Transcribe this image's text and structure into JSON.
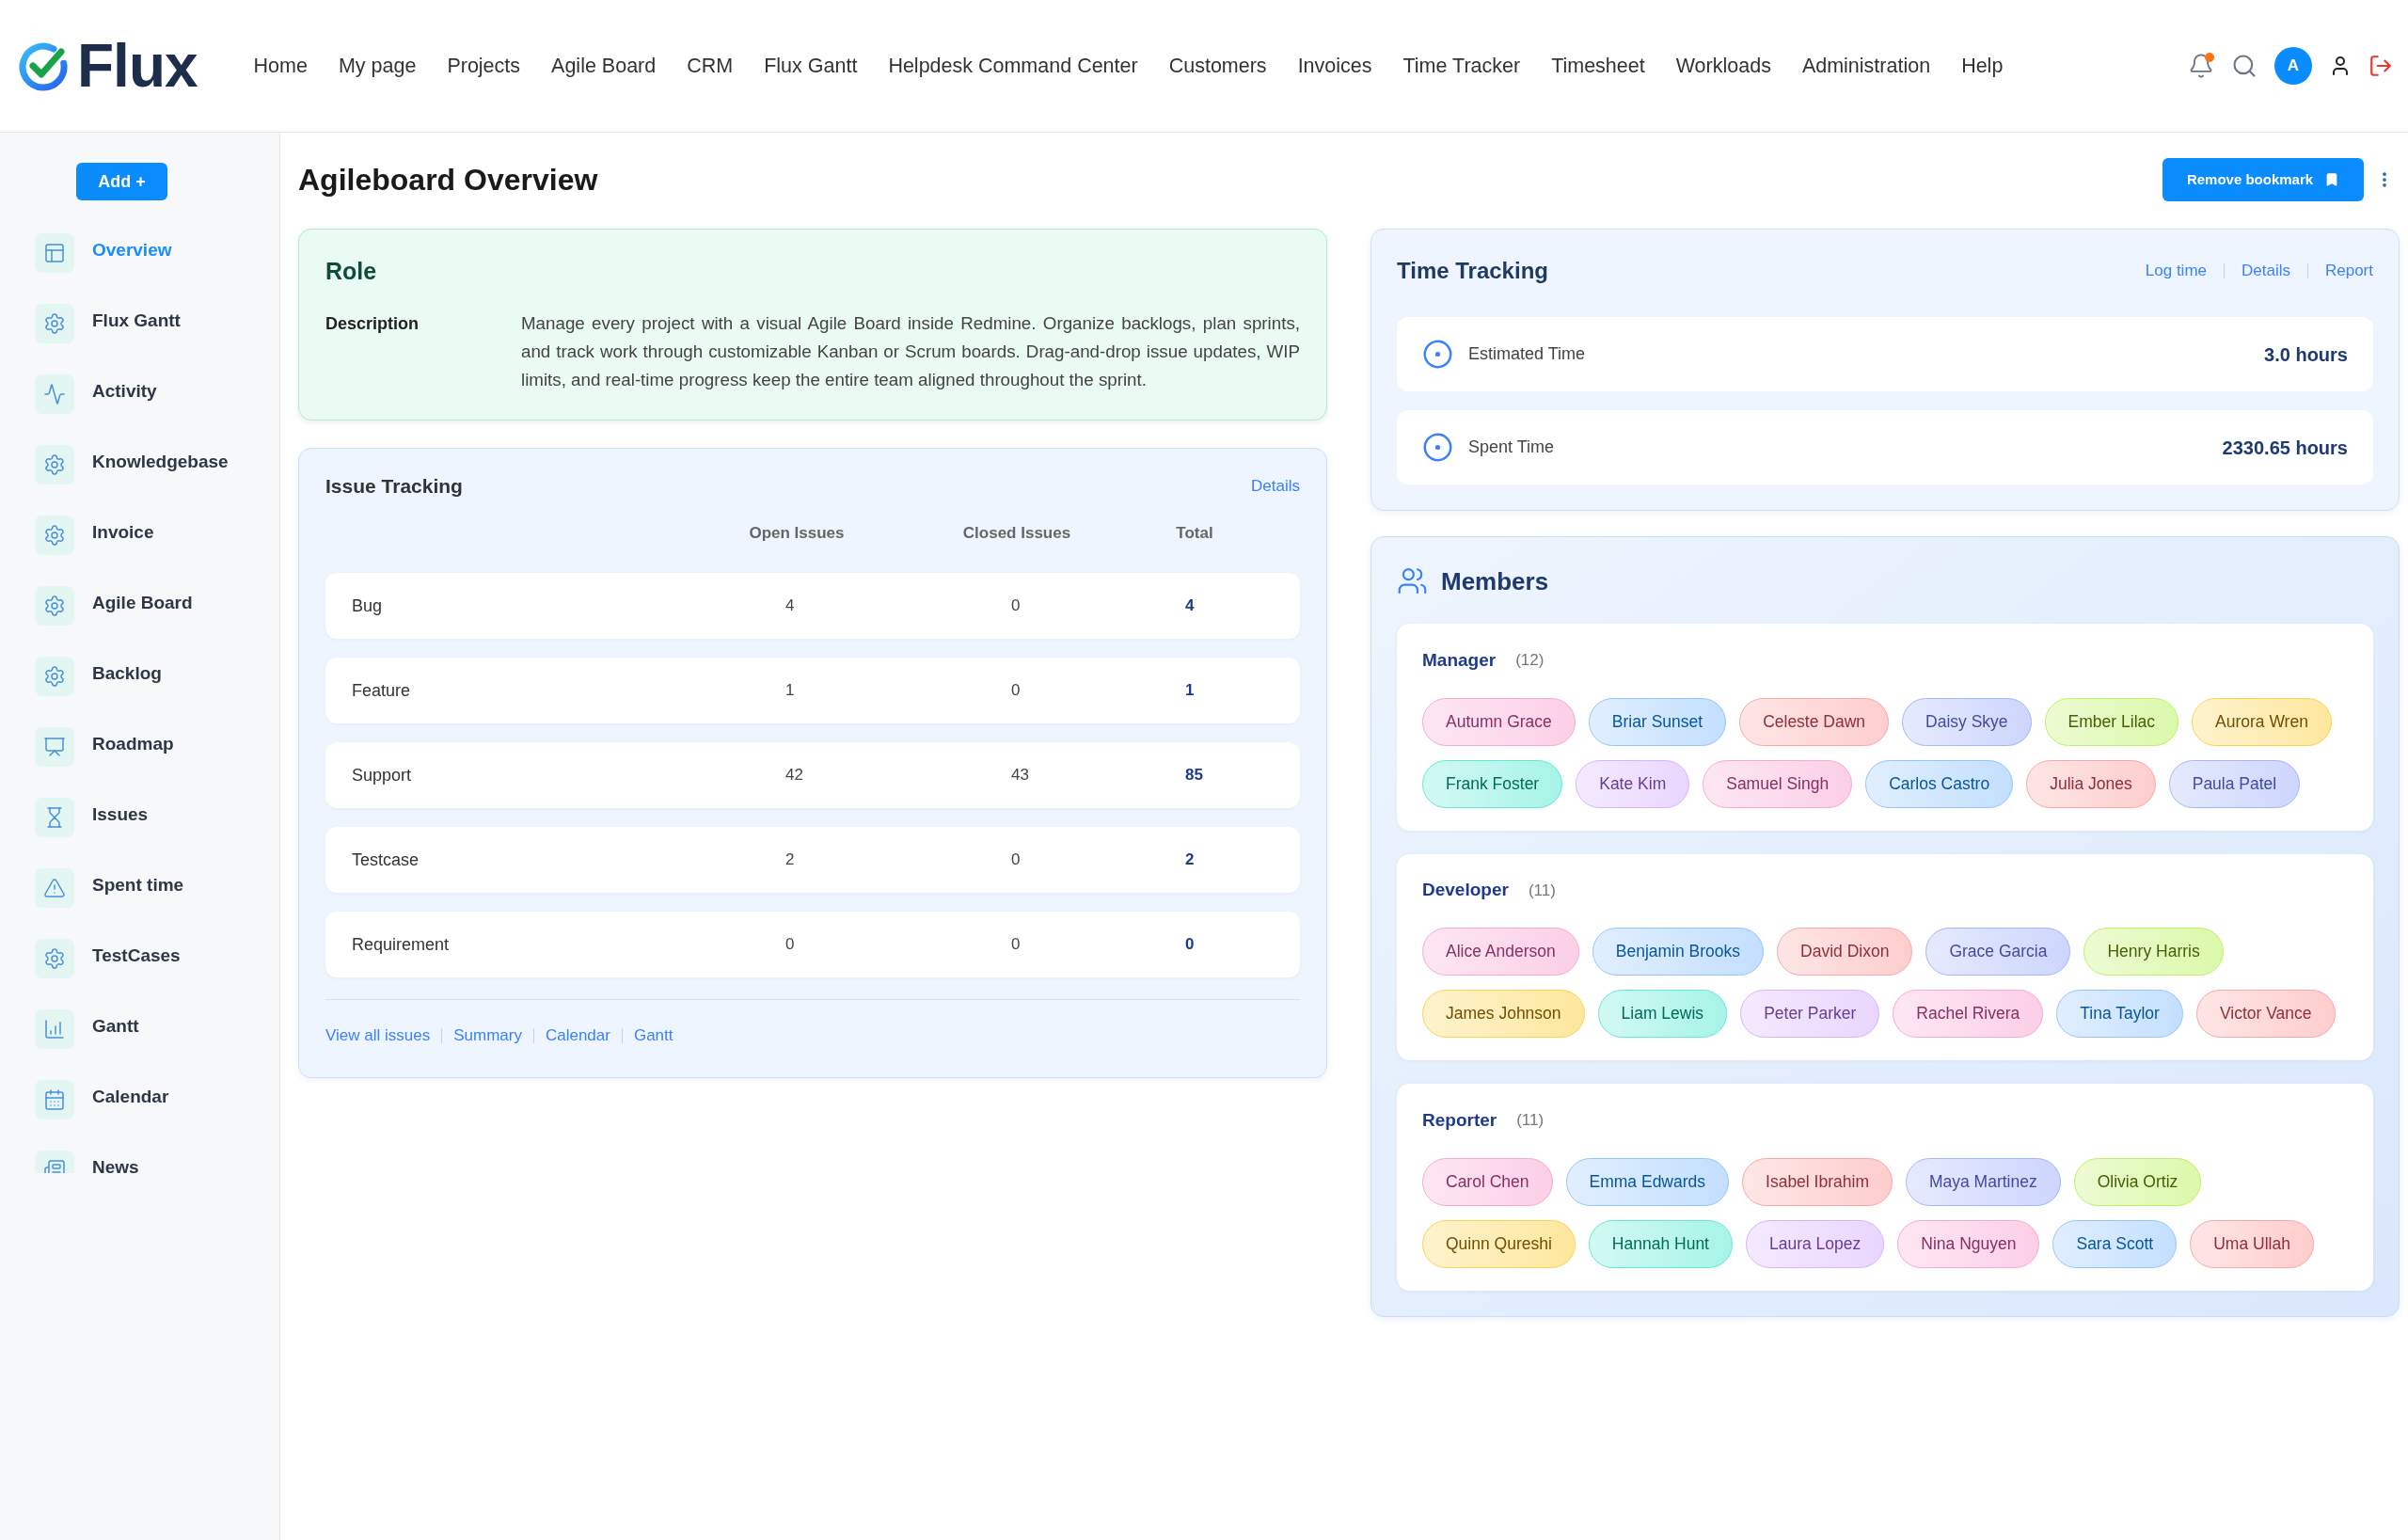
{
  "header": {
    "logo": "Flux",
    "nav": [
      "Home",
      "My page",
      "Projects",
      "Agile Board",
      "CRM",
      "Flux Gantt",
      "Helpdesk Command Center",
      "Customers",
      "Invoices",
      "Time Tracker",
      "Timesheet",
      "Workloads",
      "Administration",
      "Help"
    ],
    "notifications": {
      "unread": true
    },
    "avatar": "A"
  },
  "sidebar": {
    "add_button": "Add +",
    "items": [
      {
        "label": "Overview",
        "selected": true
      },
      {
        "label": "Flux Gantt",
        "selected": false
      },
      {
        "label": "Activity",
        "selected": false
      },
      {
        "label": "Knowledgebase",
        "selected": false
      },
      {
        "label": "Invoice",
        "selected": false
      },
      {
        "label": "Agile Board",
        "selected": false
      },
      {
        "label": "Backlog",
        "selected": false
      },
      {
        "label": "Roadmap",
        "selected": false
      },
      {
        "label": "Issues",
        "selected": false
      },
      {
        "label": "Spent time",
        "selected": false
      },
      {
        "label": "TestCases",
        "selected": false
      },
      {
        "label": "Gantt",
        "selected": false
      },
      {
        "label": "Calendar",
        "selected": false
      },
      {
        "label": "News",
        "selected": false
      }
    ]
  },
  "page": {
    "title": "Agileboard Overview",
    "bookmark_button": "Remove bookmark"
  },
  "role": {
    "title": "Role",
    "description_label": "Description",
    "description": "Manage every project with a visual Agile Board inside Redmine. Organize backlogs, plan sprints, and track work through customizable Kanban or Scrum boards. Drag-and-drop issue updates, WIP limits, and real-time progress keep the entire team aligned throughout the sprint."
  },
  "issue_tracking": {
    "title": "Issue Tracking",
    "details_link": "Details",
    "columns": [
      "Open Issues",
      "Closed Issues",
      "Total"
    ],
    "rows": [
      {
        "tracker": "Bug",
        "open": "4",
        "closed": "0",
        "total": "4"
      },
      {
        "tracker": "Feature",
        "open": "1",
        "closed": "0",
        "total": "1"
      },
      {
        "tracker": "Support",
        "open": "42",
        "closed": "43",
        "total": "85"
      },
      {
        "tracker": "Testcase",
        "open": "2",
        "closed": "0",
        "total": "2"
      },
      {
        "tracker": "Requirement",
        "open": "0",
        "closed": "0",
        "total": "0"
      }
    ],
    "links": [
      "View all issues",
      "Summary",
      "Calendar",
      "Gantt"
    ]
  },
  "time_tracking": {
    "title": "Time Tracking",
    "links": [
      "Log time",
      "Details",
      "Report"
    ],
    "rows": [
      {
        "label": "Estimated Time",
        "value": "3.0 hours"
      },
      {
        "label": "Spent Time",
        "value": "2330.65 hours"
      }
    ]
  },
  "members": {
    "title": "Members",
    "groups": [
      {
        "role": "Manager",
        "count": "(12)",
        "members": [
          {
            "name": "Autumn Grace",
            "color": "#f9a8d4"
          },
          {
            "name": "Briar Sunset",
            "color": "#93c5fd"
          },
          {
            "name": "Celeste Dawn",
            "color": "#fca5a5"
          },
          {
            "name": "Daisy Skye",
            "color": "#a5b4fc"
          },
          {
            "name": "Ember Lilac",
            "color": "#bef264"
          },
          {
            "name": "Aurora Wren",
            "color": "#fcd34d"
          },
          {
            "name": "Frank Foster",
            "color": "#5eead4"
          },
          {
            "name": "Kate Kim",
            "color": "#d8b4fe"
          },
          {
            "name": "Samuel Singh",
            "color": "#f9a8d4"
          },
          {
            "name": "Carlos Castro",
            "color": "#93c5fd"
          },
          {
            "name": "Julia Jones",
            "color": "#fca5a5"
          },
          {
            "name": "Paula Patel",
            "color": "#a5b4fc"
          }
        ]
      },
      {
        "role": "Developer",
        "count": "(11)",
        "members": [
          {
            "name": "Alice Anderson",
            "color": "#f9a8d4"
          },
          {
            "name": "Benjamin Brooks",
            "color": "#93c5fd"
          },
          {
            "name": "David Dixon",
            "color": "#fca5a5"
          },
          {
            "name": "Grace Garcia",
            "color": "#a5b4fc"
          },
          {
            "name": "Henry Harris",
            "color": "#bef264"
          },
          {
            "name": "James Johnson",
            "color": "#fcd34d"
          },
          {
            "name": "Liam Lewis",
            "color": "#5eead4"
          },
          {
            "name": "Peter Parker",
            "color": "#d8b4fe"
          },
          {
            "name": "Rachel Rivera",
            "color": "#f9a8d4"
          },
          {
            "name": "Tina Taylor",
            "color": "#93c5fd"
          },
          {
            "name": "Victor Vance",
            "color": "#fca5a5"
          }
        ]
      },
      {
        "role": "Reporter",
        "count": "(11)",
        "members": [
          {
            "name": "Carol Chen",
            "color": "#f9a8d4"
          },
          {
            "name": "Emma Edwards",
            "color": "#93c5fd"
          },
          {
            "name": "Isabel Ibrahim",
            "color": "#fca5a5"
          },
          {
            "name": "Maya Martinez",
            "color": "#a5b4fc"
          },
          {
            "name": "Olivia Ortiz",
            "color": "#bef264"
          },
          {
            "name": "Quinn Qureshi",
            "color": "#fcd34d"
          },
          {
            "name": "Hannah Hunt",
            "color": "#5eead4"
          },
          {
            "name": "Laura Lopez",
            "color": "#d8b4fe"
          },
          {
            "name": "Nina Nguyen",
            "color": "#f9a8d4"
          },
          {
            "name": "Sara Scott",
            "color": "#93c5fd"
          },
          {
            "name": "Uma Ullah",
            "color": "#fca5a5"
          }
        ]
      }
    ]
  }
}
